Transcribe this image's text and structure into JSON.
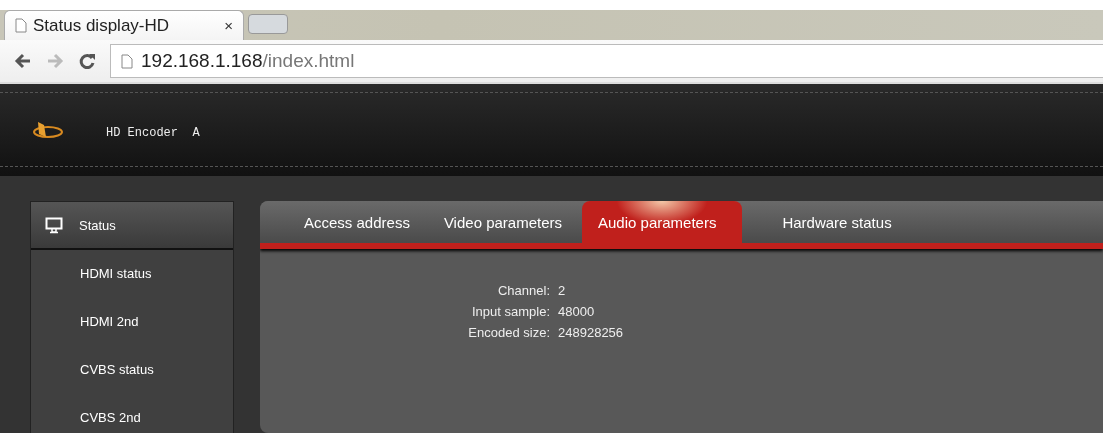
{
  "browser": {
    "tab_title": "Status display-HD",
    "tab_close": "×",
    "address_host": "192.168.1.168",
    "address_path": "/index.html"
  },
  "header": {
    "title": "HD Encoder  A"
  },
  "sidebar": {
    "section": "Status",
    "items": [
      {
        "label": "HDMI status",
        "selected": false
      },
      {
        "label": "HDMI 2nd",
        "selected": false
      },
      {
        "label": "CVBS status",
        "selected": false
      },
      {
        "label": "CVBS 2nd",
        "selected": false
      }
    ]
  },
  "tabs": [
    {
      "label": "Access address",
      "selected": false
    },
    {
      "label": "Video parameters",
      "selected": false
    },
    {
      "label": "Audio parameters",
      "selected": true
    },
    {
      "label": "Hardware status",
      "selected": false
    }
  ],
  "fields": [
    {
      "label": "Channel:",
      "value": "2"
    },
    {
      "label": "Input sample:",
      "value": "48000"
    },
    {
      "label": "Encoded size:",
      "value": "248928256"
    }
  ]
}
